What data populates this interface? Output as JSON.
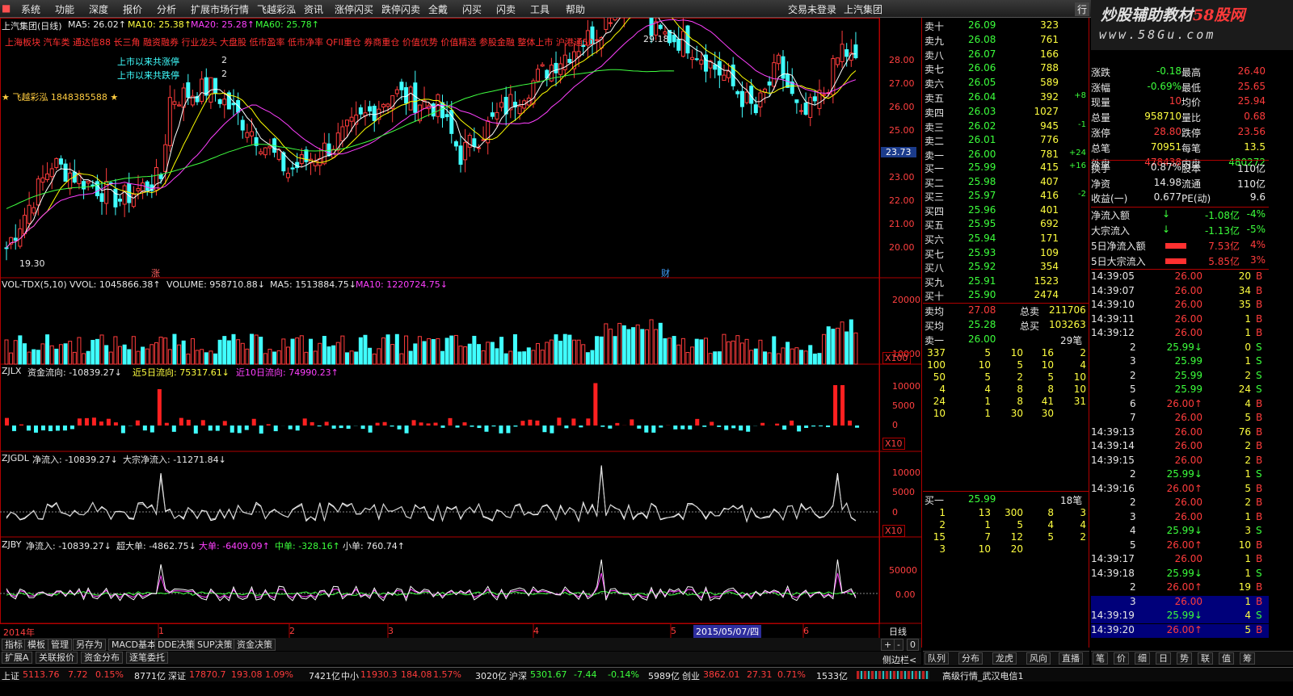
{
  "menu": {
    "items": [
      "系统",
      "功能",
      "深度",
      "报价",
      "分析",
      "扩展市场行情",
      "飞越彩泓",
      "资讯",
      "涨停闪买",
      "跌停闪卖",
      "全戴",
      "闪买",
      "闪卖",
      "工具",
      "帮助"
    ],
    "center_a": "交易未登录",
    "center_b": "上汽集团",
    "right": "行"
  },
  "logo": {
    "line1a": "炒股辅助教材",
    "line1b": "58股网",
    "line2": "www.58Gu.com"
  },
  "main_chart": {
    "title": "上汽集团(日线)",
    "ma5": "MA5: 26.02↑",
    "ma10": "MA10: 25.38↑",
    "ma20": "MA20: 25.28↑",
    "ma60": "MA60: 25.78↑",
    "concepts": "上海板块 汽车类 通达信88 长三角 融资融券 行业龙头 大盘股 低市盈率 低市净率 QFII重仓 券商重仓 价值优势 价值精选 参股金融 整体上市 沪港通50",
    "limitup_label": "上市以来共涨停",
    "limitup_val": "2",
    "limitdn_label": "上市以来共跌停",
    "limitdn_val": "2",
    "brand": "飞越彩泓 1848385588",
    "high_mark": "29.18",
    "low_mark": "19.30",
    "mark_zhang": "涨",
    "mark_cai": "财",
    "y_ticks": [
      "28.00",
      "27.00",
      "26.00",
      "25.00",
      "24.00",
      "23.00",
      "22.00",
      "21.00",
      "20.00"
    ],
    "cursor_price": "23.73"
  },
  "vol_panel": {
    "name": "VOL-TDX(5,10)",
    "vvol": "VVOL: 1045866.38↑",
    "volume": "VOLUME: 958710.88↓",
    "ma5": "MA5: 1513884.75↓",
    "ma10": "MA10: 1220724.75↓",
    "y_ticks": [
      "20000",
      "10000"
    ],
    "unit": "X100"
  },
  "zjlx_panel": {
    "name": "ZJLX",
    "a": "资金流向: -10839.27↓",
    "b": "近5日流向: 75317.61↓",
    "c": "近10日流向: 74990.23↑",
    "y_ticks": [
      "10000",
      "5000",
      "0",
      "-5000"
    ],
    "unit": "X10"
  },
  "zjgdl_panel": {
    "name": "ZJGDL",
    "a": "净流入: -10839.27↓",
    "b": "大宗净流入: -11271.84↓",
    "y_ticks": [
      "10000",
      "5000",
      "0",
      "-5000"
    ],
    "unit": "X10"
  },
  "zjby_panel": {
    "name": "ZJBY",
    "a": "净流入: -10839.27↓",
    "b": "超大单: -4862.75↓",
    "c": "大单: -6409.09↑",
    "d": "中单: -328.16↑",
    "e": "小单: 760.74↑",
    "y_ticks": [
      "50000",
      "0.00",
      "-50000"
    ]
  },
  "xaxis": {
    "labels": [
      "2014年",
      "1",
      "2",
      "3",
      "4",
      "5",
      "6"
    ],
    "date_box": "2015/05/07/四",
    "period": "日线"
  },
  "bottom_tabs": [
    "指标",
    "模板",
    "管理",
    "另存为",
    "MACD基本",
    "DDE决策",
    "SUP决策",
    "资金决策"
  ],
  "bottom_tabs2": [
    "扩展A",
    "关联报价",
    "资金分布",
    "逐笔委托"
  ],
  "zoom": [
    "+",
    "-",
    "0"
  ],
  "sell_orders": [
    [
      "卖十",
      "26.09",
      "323"
    ],
    [
      "卖九",
      "26.08",
      "761"
    ],
    [
      "卖八",
      "26.07",
      "166"
    ],
    [
      "卖七",
      "26.06",
      "788"
    ],
    [
      "卖六",
      "26.05",
      "589"
    ],
    [
      "卖五",
      "26.04",
      "392"
    ],
    [
      "卖四",
      "26.03",
      "1027"
    ],
    [
      "卖三",
      "26.02",
      "945"
    ],
    [
      "卖二",
      "26.01",
      "776"
    ],
    [
      "卖一",
      "26.00",
      "781"
    ]
  ],
  "sell_changes": [
    "",
    "",
    "",
    "",
    "",
    "+8",
    "",
    "-1",
    "",
    "+24"
  ],
  "buy_orders": [
    [
      "买一",
      "25.99",
      "415"
    ],
    [
      "买二",
      "25.98",
      "407"
    ],
    [
      "买三",
      "25.97",
      "416"
    ],
    [
      "买四",
      "25.96",
      "401"
    ],
    [
      "买五",
      "25.95",
      "692"
    ],
    [
      "买六",
      "25.94",
      "171"
    ],
    [
      "买七",
      "25.93",
      "109"
    ],
    [
      "买八",
      "25.92",
      "354"
    ],
    [
      "买九",
      "25.91",
      "1523"
    ],
    [
      "买十",
      "25.90",
      "2474"
    ]
  ],
  "buy_changes": [
    "+16",
    "",
    "-2",
    "",
    "",
    "",
    "",
    "",
    "",
    ""
  ],
  "avg": {
    "sell_label": "卖均",
    "sell_price": "27.08",
    "sell_total_label": "总卖",
    "sell_total": "211706",
    "buy_label": "买均",
    "buy_price": "25.28",
    "buy_total_label": "总买",
    "buy_total": "103263"
  },
  "queue_sell": {
    "label": "卖一",
    "price": "26.00",
    "count": "29笔",
    "rows": [
      [
        "337",
        "5",
        "10",
        "16",
        "2"
      ],
      [
        "100",
        "10",
        "5",
        "10",
        "4"
      ],
      [
        "50",
        "5",
        "2",
        "5",
        "10"
      ],
      [
        "4",
        "4",
        "8",
        "8",
        "10"
      ],
      [
        "24",
        "1",
        "8",
        "41",
        "31"
      ],
      [
        "10",
        "1",
        "30",
        "30",
        ""
      ]
    ]
  },
  "queue_buy": {
    "label": "买一",
    "price": "25.99",
    "count": "18笔",
    "rows": [
      [
        "1",
        "13",
        "300",
        "8",
        "3"
      ],
      [
        "2",
        "1",
        "5",
        "4",
        "4"
      ],
      [
        "15",
        "7",
        "12",
        "5",
        "2"
      ],
      [
        "3",
        "10",
        "20",
        "",
        ""
      ]
    ]
  },
  "quote": [
    [
      "现价",
      "26.00",
      "今开",
      "26.20"
    ],
    [
      "涨跌",
      "-0.18",
      "最高",
      "26.40"
    ],
    [
      "涨幅",
      "-0.69%",
      "最低",
      "25.65"
    ],
    [
      "现量",
      "10",
      "均价",
      "25.94"
    ],
    [
      "总量",
      "958710",
      "量比",
      "0.68"
    ],
    [
      "涨停",
      "28.80",
      "跌停",
      "23.56"
    ],
    [
      "总笔",
      "70951",
      "每笔",
      "13.5"
    ],
    [
      "外盘",
      "478438",
      "内盘",
      "480272"
    ]
  ],
  "fin": [
    [
      "换手",
      "0.87%",
      "股本",
      "110亿"
    ],
    [
      "净资",
      "14.98",
      "流通",
      "110亿"
    ],
    [
      "收益(一)",
      "0.677",
      "PE(动)",
      "9.6"
    ]
  ],
  "flow": [
    [
      "净流入额",
      "-1.08亿",
      "-4%"
    ],
    [
      "大宗流入",
      "-1.13亿",
      "-5%"
    ],
    [
      "5日净流入额",
      "7.53亿",
      "4%"
    ],
    [
      "5日大宗流入",
      "5.85亿",
      "3%"
    ]
  ],
  "ticks": [
    [
      "14:39:05",
      "26.00",
      "20",
      "B"
    ],
    [
      "14:39:07",
      "26.00",
      "34",
      "B"
    ],
    [
      "14:39:10",
      "26.00",
      "35",
      "B"
    ],
    [
      "14:39:11",
      "26.00",
      "1",
      "B"
    ],
    [
      "14:39:12",
      "26.00",
      "1",
      "B"
    ],
    [
      "2",
      "25.99↓",
      "0",
      "S"
    ],
    [
      "3",
      "25.99",
      "1",
      "S"
    ],
    [
      "2",
      "25.99",
      "2",
      "S"
    ],
    [
      "5",
      "25.99",
      "24",
      "S"
    ],
    [
      "6",
      "26.00↑",
      "4",
      "B"
    ],
    [
      "7",
      "26.00",
      "5",
      "B"
    ],
    [
      "14:39:13",
      "26.00",
      "76",
      "B"
    ],
    [
      "14:39:14",
      "26.00",
      "2",
      "B"
    ],
    [
      "14:39:15",
      "26.00",
      "2",
      "B"
    ],
    [
      "2",
      "25.99↓",
      "1",
      "S"
    ],
    [
      "14:39:16",
      "26.00↑",
      "5",
      "B"
    ],
    [
      "2",
      "26.00",
      "2",
      "B"
    ],
    [
      "3",
      "26.00",
      "1",
      "B"
    ],
    [
      "4",
      "25.99↓",
      "3",
      "S"
    ],
    [
      "5",
      "26.00↑",
      "10",
      "B"
    ],
    [
      "14:39:17",
      "26.00",
      "1",
      "B"
    ],
    [
      "14:39:18",
      "25.99↓",
      "1",
      "S"
    ],
    [
      "2",
      "26.00↑",
      "19",
      "B"
    ],
    [
      "3",
      "26.00",
      "1",
      "B"
    ],
    [
      "14:39:19",
      "25.99↓",
      "4",
      "S"
    ],
    [
      "14:39:20",
      "26.00↑",
      "5",
      "B"
    ]
  ],
  "side_tabs": [
    "队列",
    "分布",
    "龙虎",
    "风向",
    "直播"
  ],
  "side_tabs2": [
    "笔",
    "价",
    "细",
    "日",
    "势",
    "联",
    "值",
    "筹"
  ],
  "status": {
    "sh": "上证",
    "sh_idx": "5113.76",
    "sh_chg": "7.72",
    "sh_pct": "0.15%",
    "sh_amt": "8771亿",
    "sz": "深证",
    "sz_idx": "17870.7",
    "sz_chg": "193.08",
    "sz_pct": "1.09%",
    "sz_amt": "7421亿",
    "zx": "中小",
    "zx_idx": "11930.3",
    "zx_chg": "184.08",
    "zx_pct": "1.57%",
    "zx_amt": "3020亿",
    "hs": "沪深",
    "hs_idx": "5301.67",
    "hs_chg": "-7.44",
    "hs_pct": "-0.14%",
    "hs_amt": "5989亿",
    "cy": "创业",
    "cy_idx": "3862.01",
    "cy_chg": "27.31",
    "cy_pct": "0.71%",
    "cy_amt": "1533亿",
    "conn": "高级行情_武汉电信1",
    "side_label": "侧边栏<"
  },
  "colors": {
    "up": "#ff3c3c",
    "down": "#40ffff",
    "ma5": "#ffffff",
    "ma10": "#ffff00",
    "ma20": "#ff40ff",
    "ma60": "#40ff40",
    "grid": "#b00000"
  }
}
